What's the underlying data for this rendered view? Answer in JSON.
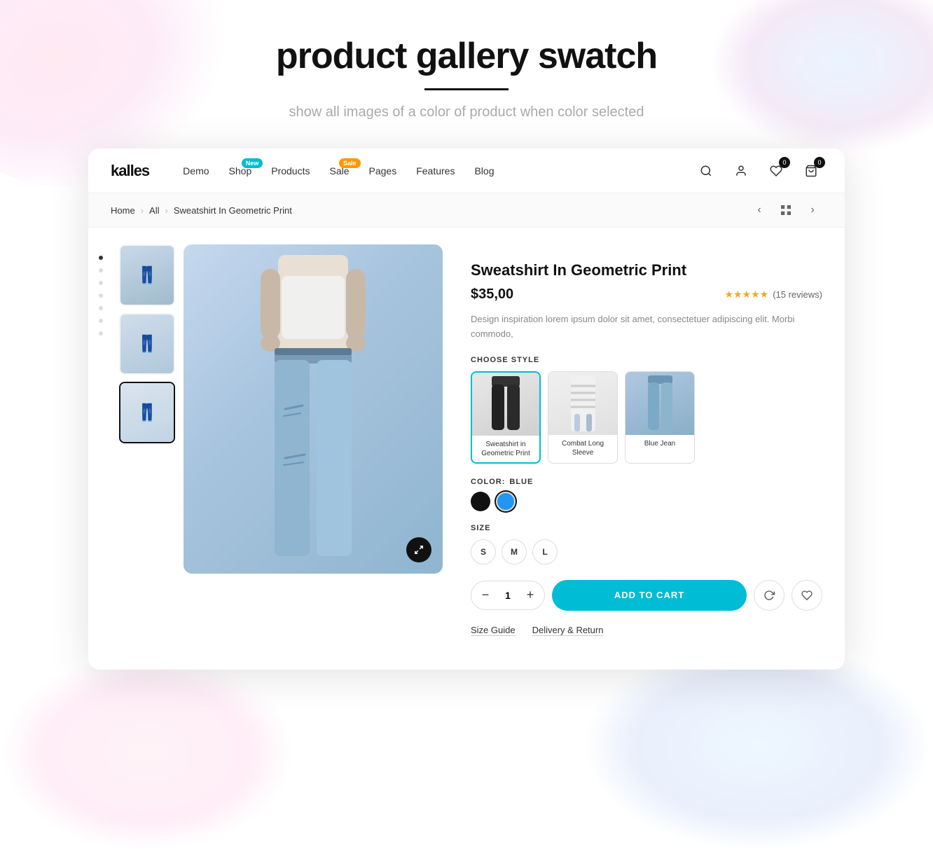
{
  "hero": {
    "title": "product gallery swatch",
    "subtitle": "show all images of a color of product when color selected"
  },
  "nav": {
    "logo": "kalles",
    "links": [
      {
        "label": "Demo",
        "badge": null
      },
      {
        "label": "Shop",
        "badge": {
          "text": "New",
          "type": "new"
        }
      },
      {
        "label": "Products",
        "badge": null
      },
      {
        "label": "Sale",
        "badge": {
          "text": "Sale",
          "type": "sale"
        }
      },
      {
        "label": "Pages",
        "badge": null
      },
      {
        "label": "Features",
        "badge": null
      },
      {
        "label": "Blog",
        "badge": null
      }
    ],
    "cart_count": "0",
    "wishlist_count": "0"
  },
  "breadcrumb": {
    "home": "Home",
    "all": "All",
    "current": "Sweatshirt In Geometric Print"
  },
  "product": {
    "title": "Sweatshirt In Geometric Print",
    "price": "$35,00",
    "rating_stars": "★★★★★",
    "rating_count": "(15 reviews)",
    "description": "Design inspiration lorem ipsum dolor sit amet, consectetuer adipiscing elit. Morbi commodo,",
    "choose_style_label": "CHOOSE STYLE",
    "styles": [
      {
        "label": "Sweatshirt in\nGeometric Print",
        "selected": true
      },
      {
        "label": "Combat Long Sleeve",
        "selected": false
      },
      {
        "label": "Blue Jean",
        "selected": false
      }
    ],
    "color_label": "COLOR:",
    "color_value": "BLUE",
    "colors": [
      {
        "name": "black",
        "hex": "#111111",
        "selected": false
      },
      {
        "name": "blue",
        "hex": "#2196F3",
        "selected": true
      }
    ],
    "size_label": "SIZE",
    "sizes": [
      {
        "label": "S",
        "selected": false
      },
      {
        "label": "M",
        "selected": false
      },
      {
        "label": "L",
        "selected": false
      }
    ],
    "quantity": "1",
    "add_to_cart_label": "ADD TO CART",
    "size_guide_label": "Size Guide",
    "delivery_return_label": "Delivery & Return"
  }
}
